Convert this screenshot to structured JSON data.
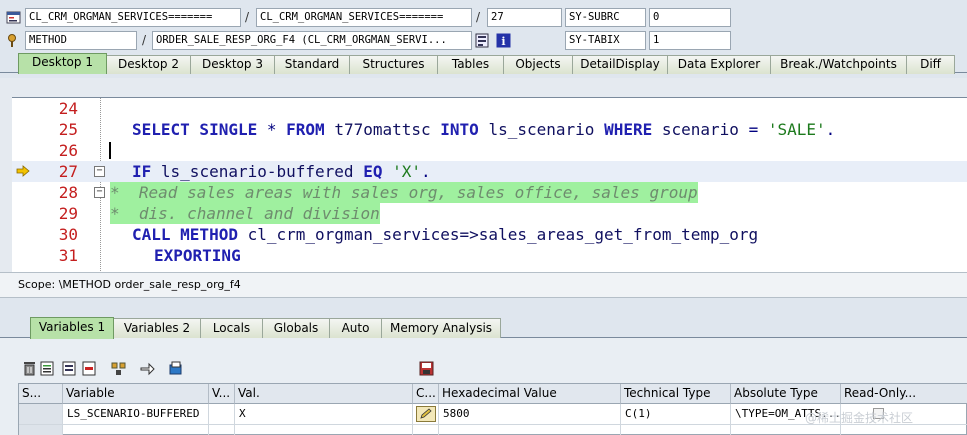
{
  "info": {
    "program1": "CL_CRM_ORGMAN_SERVICES=======",
    "program2": "CL_CRM_ORGMAN_SERVICES=======",
    "line": "27",
    "sy_subrc_label": "SY-SUBRC",
    "sy_subrc_value": "0",
    "event_type": "METHOD",
    "event_name": "ORDER_SALE_RESP_ORG_F4 (CL_CRM_ORGMAN_SERVI...",
    "sy_tabix_label": "SY-TABIX",
    "sy_tabix_value": "1"
  },
  "desktop_tabs": [
    "Desktop 1",
    "Desktop 2",
    "Desktop 3",
    "Standard",
    "Structures",
    "Tables",
    "Objects",
    "DetailDisplay",
    "Data Explorer",
    "Break./Watchpoints",
    "Diff"
  ],
  "active_desktop_tab": "Desktop 1",
  "code": {
    "lines": [
      {
        "num": "24",
        "text": ""
      },
      {
        "num": "25",
        "text": "SELECT SINGLE * FROM t77omattsc INTO ls_scenario WHERE scenario = 'SALE'."
      },
      {
        "num": "26",
        "text": ""
      },
      {
        "num": "27",
        "text": "IF ls_scenario-buffered EQ 'X'."
      },
      {
        "num": "28",
        "text": "*  Read sales areas with sales org, sales office, sales group"
      },
      {
        "num": "29",
        "text": "*  dis. channel and division"
      },
      {
        "num": "30",
        "text": "CALL METHOD cl_crm_orgman_services=>sales_areas_get_from_temp_org"
      },
      {
        "num": "31",
        "text": "EXPORTING"
      }
    ],
    "current_line": "27"
  },
  "scope": "Scope: \\METHOD order_sale_resp_org_f4",
  "var_tabs": [
    "Variables 1",
    "Variables 2",
    "Locals",
    "Globals",
    "Auto",
    "Memory Analysis"
  ],
  "active_var_tab": "Variables 1",
  "table": {
    "headers": [
      "S...",
      "Variable",
      "V...",
      "Val.",
      "C...",
      "Hexadecimal Value",
      "Technical Type",
      "Absolute Type",
      "Read-Only..."
    ],
    "rows": [
      {
        "variable": "LS_SCENARIO-BUFFERED",
        "value": "X",
        "hex": "5800",
        "tech_type": "C(1)",
        "abs_type": "\\TYPE=OM_ATTS..."
      }
    ]
  },
  "watermark": "@稀土掘金技术社区",
  "colors": {
    "active_tab": "#b7e1a8",
    "comment_bg": "#9ff09f",
    "line_number": "#c41e1e",
    "keyword": "#2020b0"
  }
}
